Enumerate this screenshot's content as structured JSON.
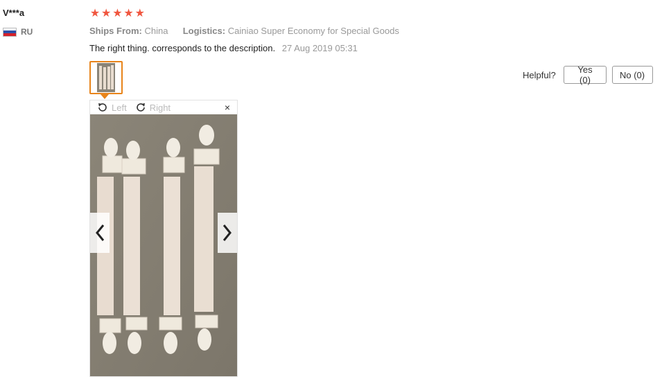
{
  "user": {
    "name": "V***a",
    "country": "RU",
    "flag_colors": [
      "#ffffff",
      "#2b4fa8",
      "#d4202a"
    ]
  },
  "rating": {
    "stars": 5,
    "star_color": "#f0563f"
  },
  "ships_from": {
    "label": "Ships From:",
    "value": "China"
  },
  "logistics": {
    "label": "Logistics:",
    "value": "Cainiao Super Economy for Special Goods"
  },
  "review": {
    "text": "The right thing. corresponds to the description.",
    "date": "27 Aug 2019 05:31"
  },
  "helpful": {
    "label": "Helpful?",
    "yes_label": "Yes (0)",
    "no_label": "No (0)"
  },
  "viewer": {
    "rotate_left_label": "Left",
    "rotate_right_label": "Right",
    "close_glyph": "×"
  },
  "accent_color": "#e8841a"
}
